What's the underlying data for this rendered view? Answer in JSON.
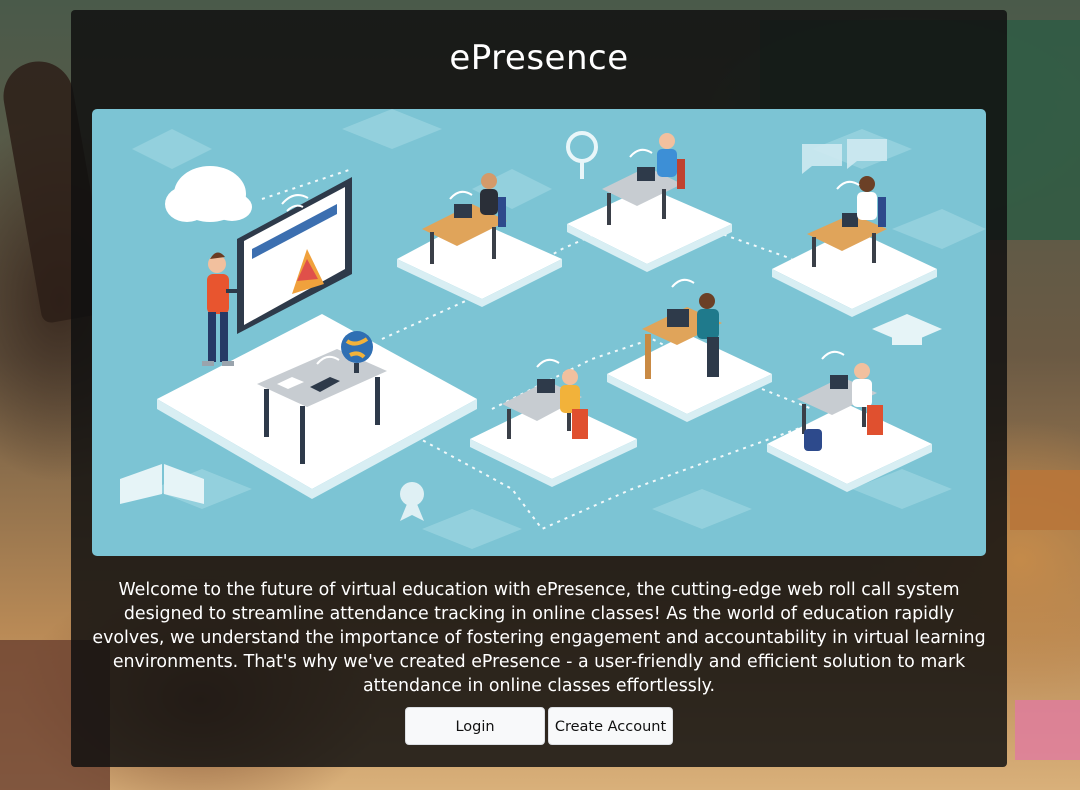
{
  "app": {
    "title": "ePresence"
  },
  "hero": {
    "illustration": "virtual-classroom-illustration",
    "background_color": "#7cc4d4"
  },
  "description": "Welcome to the future of virtual education with ePresence, the cutting-edge web roll call system designed to streamline attendance tracking in online classes! As the world of education rapidly evolves, we understand the importance of fostering engagement and accountability in virtual learning environments. That's why we've created ePresence - a user-friendly and efficient solution to mark attendance in online classes effortlessly.",
  "actions": {
    "login_label": "Login",
    "create_account_label": "Create Account"
  },
  "colors": {
    "panel_bg": "rgba(15,15,15,0.84)",
    "button_bg": "#f8f9fa",
    "text": "#ffffff"
  }
}
